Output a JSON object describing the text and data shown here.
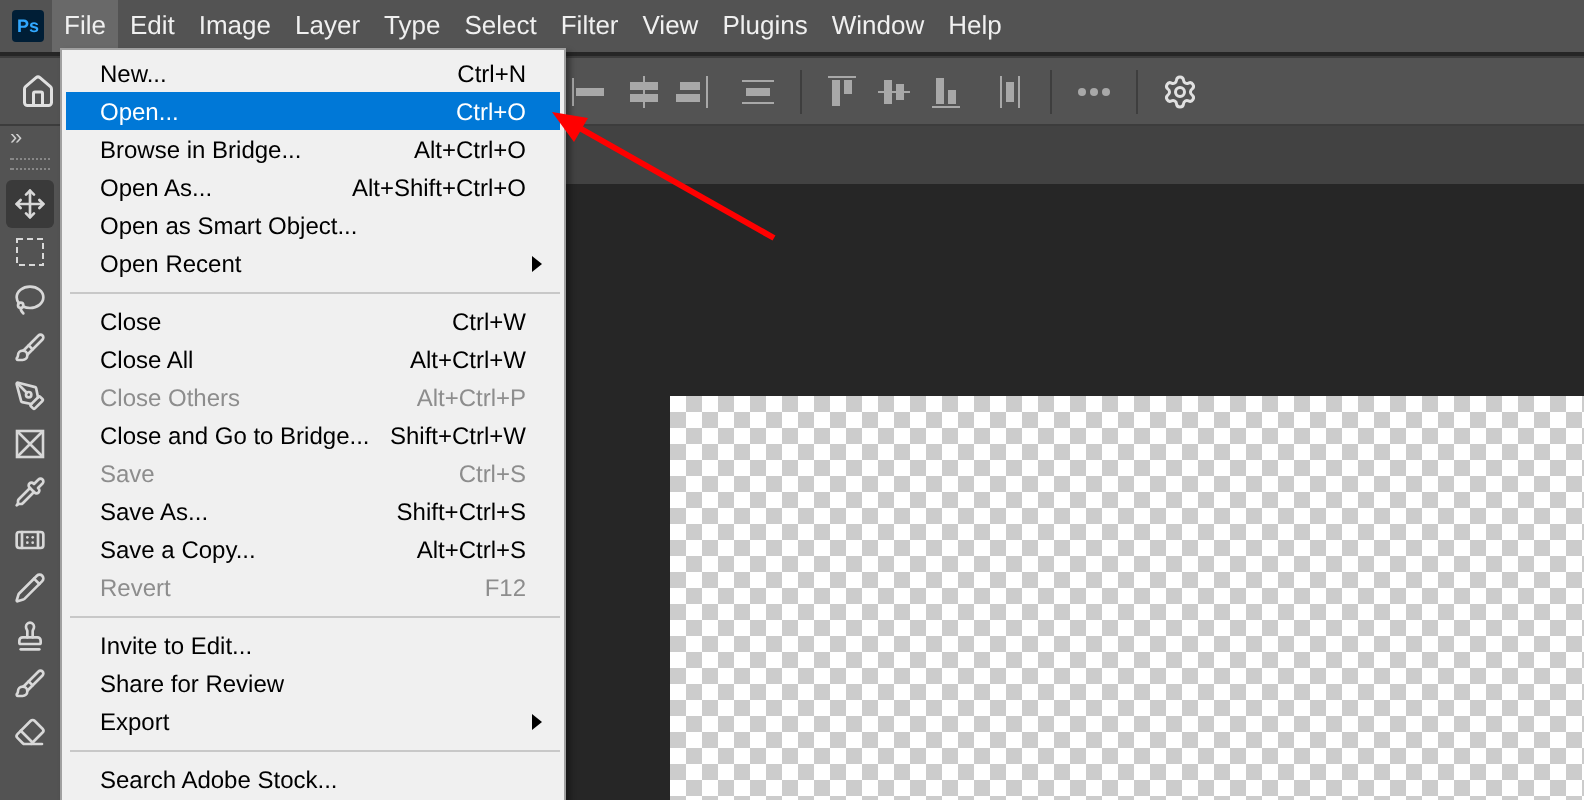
{
  "app": {
    "logo": "Ps"
  },
  "menubar": [
    {
      "label": "File",
      "selected": true
    },
    {
      "label": "Edit",
      "selected": false
    },
    {
      "label": "Image",
      "selected": false
    },
    {
      "label": "Layer",
      "selected": false
    },
    {
      "label": "Type",
      "selected": false
    },
    {
      "label": "Select",
      "selected": false
    },
    {
      "label": "Filter",
      "selected": false
    },
    {
      "label": "View",
      "selected": false
    },
    {
      "label": "Plugins",
      "selected": false
    },
    {
      "label": "Window",
      "selected": false
    },
    {
      "label": "Help",
      "selected": false
    }
  ],
  "panel_toggle": "»",
  "file_menu": [
    {
      "kind": "item",
      "label": "New...",
      "shortcut": "Ctrl+N",
      "disabled": false,
      "selected": false
    },
    {
      "kind": "item",
      "label": "Open...",
      "shortcut": "Ctrl+O",
      "disabled": false,
      "selected": true
    },
    {
      "kind": "item",
      "label": "Browse in Bridge...",
      "shortcut": "Alt+Ctrl+O",
      "disabled": false,
      "selected": false
    },
    {
      "kind": "item",
      "label": "Open As...",
      "shortcut": "Alt+Shift+Ctrl+O",
      "disabled": false,
      "selected": false
    },
    {
      "kind": "item",
      "label": "Open as Smart Object...",
      "disabled": false,
      "selected": false
    },
    {
      "kind": "submenu",
      "label": "Open Recent",
      "disabled": false,
      "selected": false
    },
    {
      "kind": "separator"
    },
    {
      "kind": "item",
      "label": "Close",
      "shortcut": "Ctrl+W",
      "disabled": false,
      "selected": false
    },
    {
      "kind": "item",
      "label": "Close All",
      "shortcut": "Alt+Ctrl+W",
      "disabled": false,
      "selected": false
    },
    {
      "kind": "item",
      "label": "Close Others",
      "shortcut": "Alt+Ctrl+P",
      "disabled": true,
      "selected": false
    },
    {
      "kind": "item",
      "label": "Close and Go to Bridge...",
      "shortcut": "Shift+Ctrl+W",
      "disabled": false,
      "selected": false
    },
    {
      "kind": "item",
      "label": "Save",
      "shortcut": "Ctrl+S",
      "disabled": true,
      "selected": false
    },
    {
      "kind": "item",
      "label": "Save As...",
      "shortcut": "Shift+Ctrl+S",
      "disabled": false,
      "selected": false
    },
    {
      "kind": "item",
      "label": "Save a Copy...",
      "shortcut": "Alt+Ctrl+S",
      "disabled": false,
      "selected": false
    },
    {
      "kind": "item",
      "label": "Revert",
      "shortcut": "F12",
      "disabled": true,
      "selected": false
    },
    {
      "kind": "separator"
    },
    {
      "kind": "item",
      "label": "Invite to Edit...",
      "disabled": false,
      "selected": false
    },
    {
      "kind": "item",
      "label": "Share for Review",
      "disabled": false,
      "selected": false
    },
    {
      "kind": "submenu",
      "label": "Export",
      "disabled": false,
      "selected": false
    },
    {
      "kind": "separator"
    },
    {
      "kind": "item",
      "label": "Search Adobe Stock...",
      "disabled": false,
      "selected": false
    }
  ]
}
